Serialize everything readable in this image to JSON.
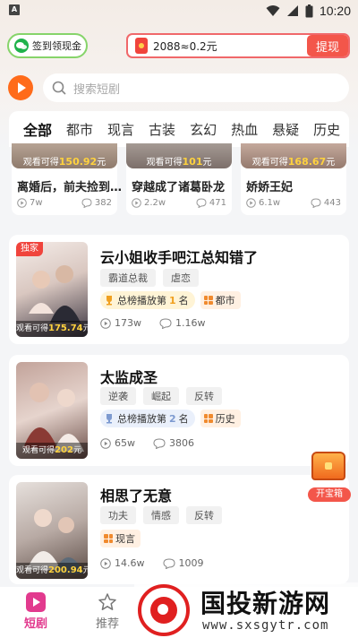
{
  "status_bar": {
    "time": "10:20",
    "left_icon": "A"
  },
  "rewards": {
    "checkin_label": "签到领现金",
    "coins_text": "2088≈0.2元",
    "withdraw_label": "提现"
  },
  "search": {
    "placeholder": "搜索短剧"
  },
  "categories": [
    "全部",
    "都市",
    "现言",
    "古装",
    "玄幻",
    "热血",
    "悬疑",
    "历史"
  ],
  "top_cards": [
    {
      "earn_prefix": "观看可得",
      "earn_value": "150.92",
      "earn_suffix": "元",
      "title": "离婚后，前夫捡到…",
      "views": "7w",
      "comments": "382"
    },
    {
      "earn_prefix": "观看可得",
      "earn_value": "101",
      "earn_suffix": "元",
      "title": "穿越成了诸葛卧龙",
      "views": "2.2w",
      "comments": "471"
    },
    {
      "earn_prefix": "观看可得",
      "earn_value": "168.67",
      "earn_suffix": "元",
      "title": "娇娇王妃",
      "views": "6.1w",
      "comments": "443"
    }
  ],
  "dramas": [
    {
      "exclusive": "独家",
      "earn_prefix": "观看可得",
      "earn_value": "175.74",
      "earn_suffix": "元",
      "title": "云小姐收手吧江总知错了",
      "tags": [
        "霸道总裁",
        "虐恋"
      ],
      "rank_prefix": "总榜播放第",
      "rank_num": "1",
      "rank_suffix": "名",
      "genre": "都市",
      "views": "173w",
      "comments": "1.16w"
    },
    {
      "earn_prefix": "观看可得",
      "earn_value": "202",
      "earn_suffix": "元",
      "title": "太监成圣",
      "tags": [
        "逆袭",
        "崛起",
        "反转"
      ],
      "rank_prefix": "总榜播放第",
      "rank_num": "2",
      "rank_suffix": "名",
      "genre": "历史",
      "views": "65w",
      "comments": "3806"
    },
    {
      "earn_prefix": "观看可得",
      "earn_value": "200.94",
      "earn_suffix": "元",
      "title": "相思了无意",
      "tags": [
        "功夫",
        "情感",
        "反转"
      ],
      "genre": "现言",
      "views": "14.6w",
      "comments": "1009"
    }
  ],
  "treasure": {
    "label": "开宝箱"
  },
  "bottom_nav": [
    {
      "label": "短剧",
      "icon": "dramas-icon",
      "active": true
    },
    {
      "label": "推荐",
      "icon": "star-icon",
      "active": false
    }
  ],
  "watermark": {
    "title": "国投新游网",
    "url": "www.sxsgytr.com"
  },
  "colors": {
    "accent_pink": "#e23a8e",
    "accent_red": "#f3564a",
    "gold": "#ffd23e",
    "brand_orange": "#ff6b1a"
  }
}
